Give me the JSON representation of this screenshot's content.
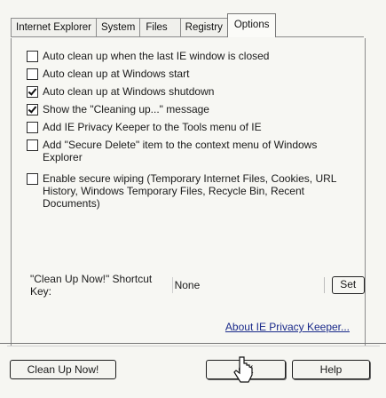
{
  "tabs": [
    {
      "label": "Internet Explorer",
      "active": false
    },
    {
      "label": "System",
      "active": false
    },
    {
      "label": "Files",
      "active": false
    },
    {
      "label": "Registry",
      "active": false
    },
    {
      "label": "Options",
      "active": true
    }
  ],
  "options": [
    {
      "label": "Auto clean up when the last IE window is closed",
      "checked": false
    },
    {
      "label": "Auto clean up at Windows start",
      "checked": false
    },
    {
      "label": "Auto clean up at Windows shutdown",
      "checked": true
    },
    {
      "label": "Show the \"Cleaning up...\" message",
      "checked": true
    },
    {
      "label": "Add IE Privacy Keeper to the Tools menu of IE",
      "checked": false
    },
    {
      "label": "Add \"Secure Delete\" item to the context menu of Windows Explorer",
      "checked": false
    },
    {
      "label": "Enable secure wiping (Temporary Internet Files, Cookies, URL History, Windows Temporary Files, Recycle Bin, Recent Documents)",
      "checked": false
    }
  ],
  "shortcut": {
    "label": "\"Clean Up Now!\" Shortcut Key:",
    "value": "None",
    "set_label": "Set"
  },
  "about_link": "About IE Privacy Keeper...",
  "buttons": {
    "clean_up": "Clean Up Now!",
    "ok": "OK",
    "help": "Help"
  }
}
